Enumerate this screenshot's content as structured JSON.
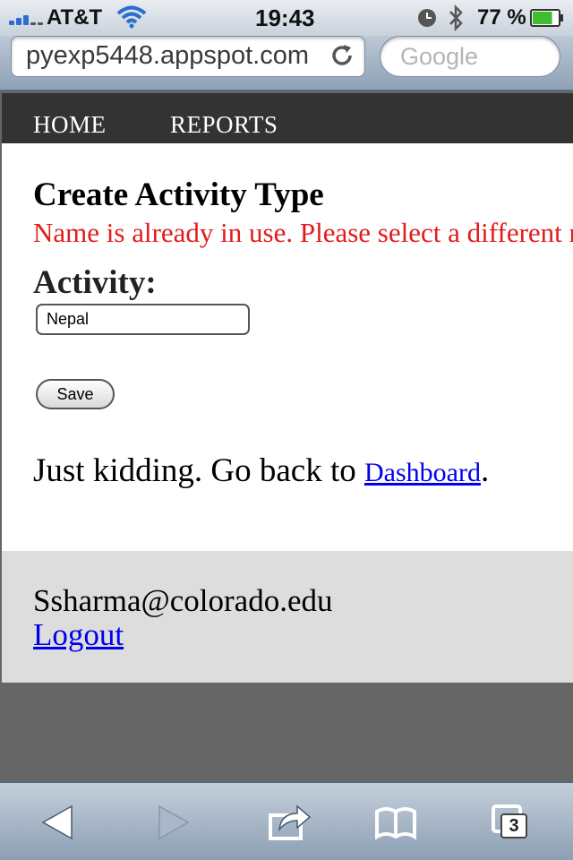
{
  "status_bar": {
    "carrier": "AT&T",
    "time": "19:43",
    "battery_percent": "77 %",
    "battery_level": 0.77
  },
  "browser": {
    "url": "pyexp5448.appspot.com",
    "search_placeholder": "Google",
    "tab_count": "3"
  },
  "nav": {
    "home_label": "HOME",
    "reports_label": "REPORTS"
  },
  "form": {
    "title": "Create Activity Type",
    "error_message": "Name is already in use. Please select a different name.",
    "activity_label": "Activity:",
    "activity_value": "Nepal",
    "save_label": "Save"
  },
  "back": {
    "prefix": "Just kidding. Go back to ",
    "link_label": "Dashboard",
    "suffix": "."
  },
  "footer": {
    "user_email": "Ssharma@colorado.edu",
    "logout_label": "Logout"
  },
  "colors": {
    "error": "#e31b1b",
    "link": "#0000ee",
    "navbar_bg": "#333333",
    "footer_bg": "#dddddd"
  }
}
